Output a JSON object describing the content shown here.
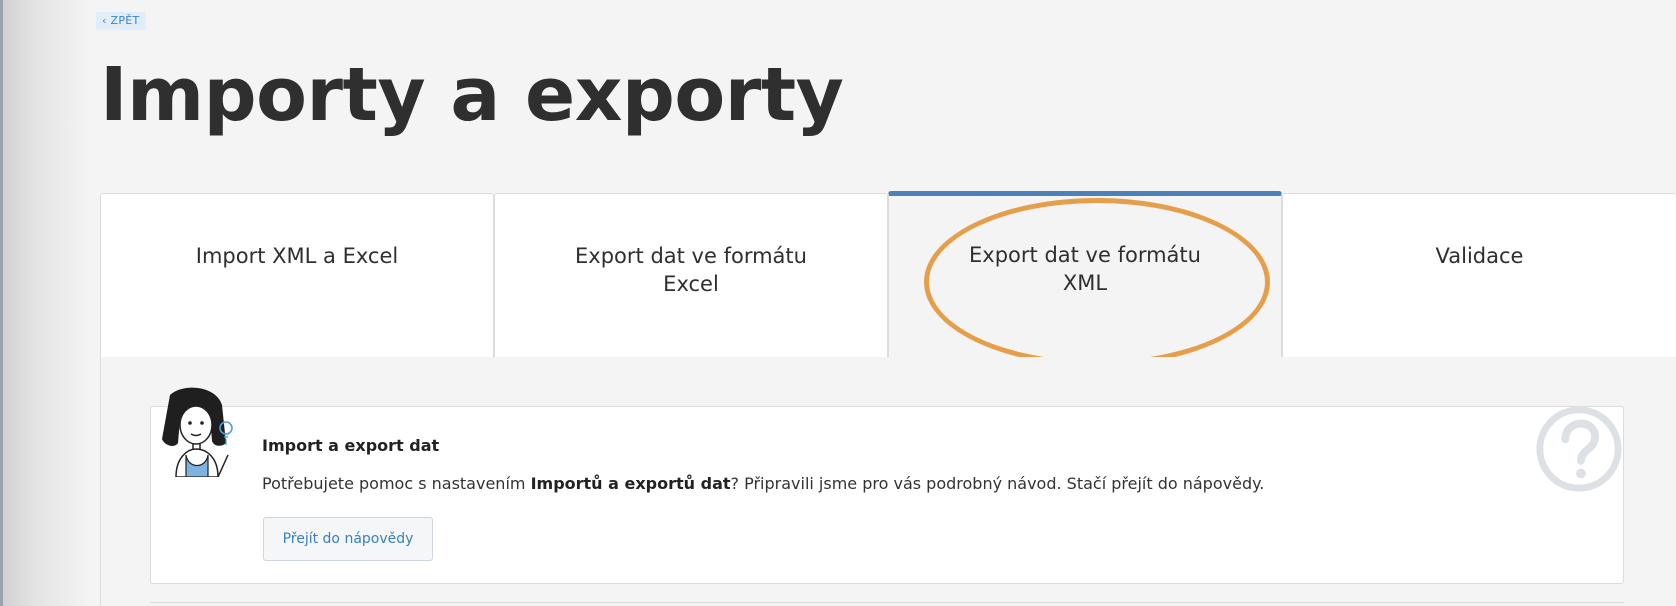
{
  "nav": {
    "back_label": "‹ ZPĚT"
  },
  "page": {
    "title": "Importy a exporty"
  },
  "tabs": [
    {
      "label": "Import XML a Excel",
      "active": false
    },
    {
      "label": "Export dat ve formátu\nExcel",
      "active": false
    },
    {
      "label": "Export dat ve formátu\nXML",
      "active": true
    },
    {
      "label": "Validace",
      "active": false
    }
  ],
  "help": {
    "title": "Import a export dat",
    "text_before": "Potřebujete pomoc s nastavením ",
    "text_bold": "Importů a exportů dat",
    "text_after": "? Připravili jsme pro vás podrobný návod. Stačí přejít do nápovědy.",
    "button_label": "Přejít do nápovědy",
    "icons": [
      "assistant-girl-icon",
      "lightbulb-icon",
      "question-mark-icon"
    ]
  },
  "colors": {
    "accent": "#4d7fb8",
    "highlight": "#e59e49",
    "link": "#3a87c8"
  }
}
